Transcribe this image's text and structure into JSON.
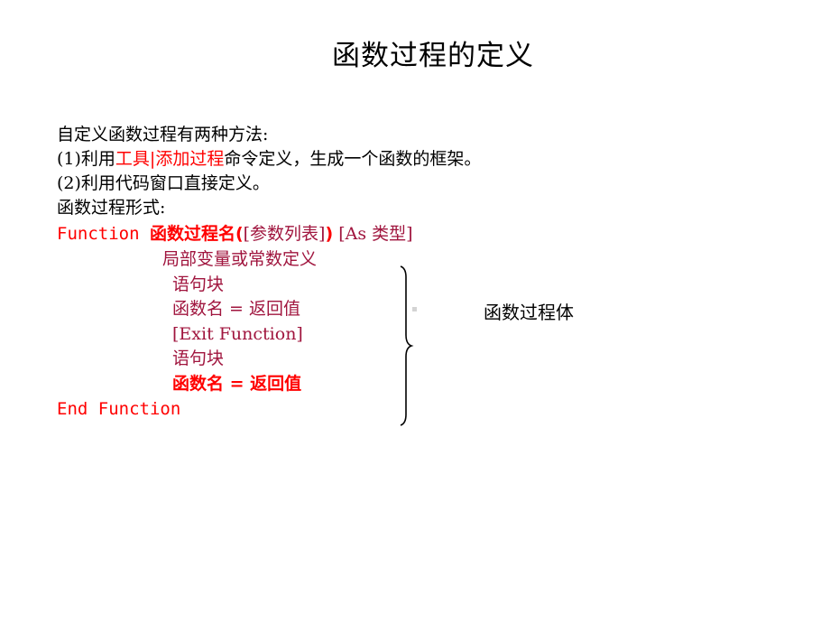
{
  "slide": {
    "title": "函数过程的定义",
    "intro": {
      "line1": "自定义函数过程有两种方法:",
      "line2_prefix": "(1)利用",
      "line2_menu": "工具|添加过程",
      "line2_suffix": "命令定义，生成一个函数的框架。",
      "line3": "(2)利用代码窗口直接定义。",
      "line4": "函数过程形式:"
    },
    "syntax": {
      "header_keyword": "Function ",
      "header_name": "函数过程名(",
      "header_params": "[参数列表]",
      "header_close": ")",
      "header_type": " [As 类型]",
      "local_decl": "局部变量或常数定义",
      "stmt_block_1": "语句块",
      "assign_1": "函数名 = 返回值",
      "exit": "[Exit Function]",
      "stmt_block_2": "语句块",
      "assign_2": "函数名 = 返回值",
      "end": "End Function"
    },
    "brace_label": "函数过程体",
    "colors": {
      "emphasis": "#ff0000",
      "body": "#a0153e",
      "text": "#000000"
    }
  }
}
